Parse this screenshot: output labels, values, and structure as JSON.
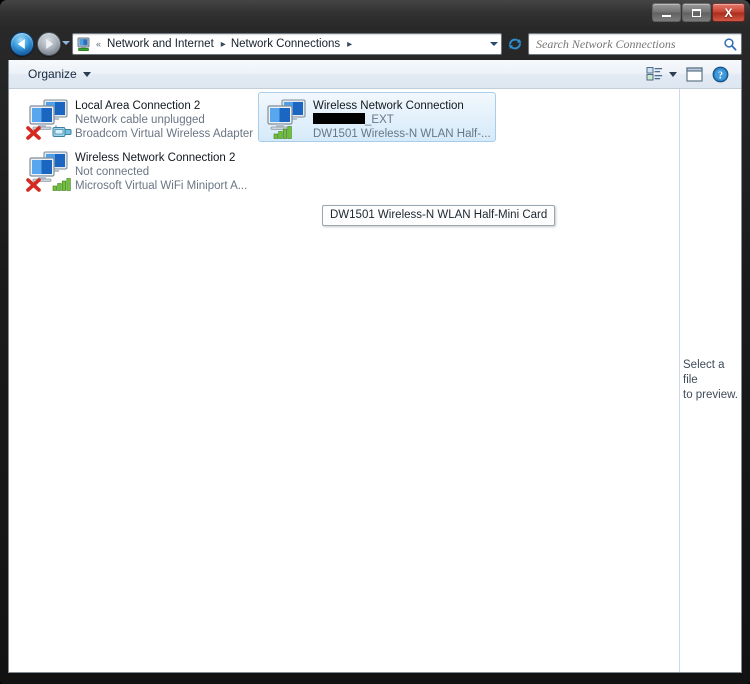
{
  "window": {
    "title": "Network Connections",
    "controls": {
      "minimize": "minimize-button",
      "maximize": "maximize-button",
      "close": "X"
    }
  },
  "navigation": {
    "back_label": "Back",
    "forward_label": "Forward",
    "recent_pages_label": "Recent pages",
    "refresh_label": "Refresh",
    "address_icon": "network-folder-icon",
    "overflow_chevron": "«",
    "breadcrumbs": [
      {
        "label": "Network and Internet"
      },
      {
        "label": "Network Connections"
      }
    ],
    "dropdown_label": "Previous locations"
  },
  "search": {
    "placeholder": "Search Network Connections",
    "value": "",
    "icon": "search-icon"
  },
  "toolbar": {
    "organize_label": "Organize",
    "views_icon": "change-view-icon",
    "preview_pane_icon": "show-preview-pane-icon",
    "help_icon": "help-icon"
  },
  "connections": [
    {
      "name": "Local Area Connection 2",
      "status": "Network cable unplugged",
      "device": "Broadcom Virtual Wireless Adapter",
      "icon": "network-adapter-disconnected-icon",
      "overlay": "red-x-icon",
      "media": "ethernet-plug-icon",
      "selected": false
    },
    {
      "name": "Wireless Network Connection 2",
      "status": "Not connected",
      "device": "Microsoft Virtual WiFi Miniport A...",
      "icon": "network-adapter-disconnected-icon",
      "overlay": "red-x-icon",
      "media": "wifi-signal-icon",
      "selected": false
    },
    {
      "name": "Wireless Network Connection",
      "status_redacted": true,
      "status": "_EXT",
      "device": "DW1501 Wireless-N WLAN Half-...",
      "icon": "network-adapter-connected-icon",
      "overlay": "",
      "media": "wifi-signal-icon",
      "selected": true
    }
  ],
  "tooltip": {
    "text": "DW1501 Wireless-N WLAN Half-Mini Card"
  },
  "preview_pane": {
    "line1": "Select a file",
    "line2": "to preview."
  },
  "colors": {
    "selection_border": "#a8cdeb",
    "selection_fill": "#e2f0fb",
    "close_button": "#c33a28",
    "signal_green": "#5bb22c",
    "error_red": "#d42a20",
    "frame": "#1b1b1b"
  }
}
